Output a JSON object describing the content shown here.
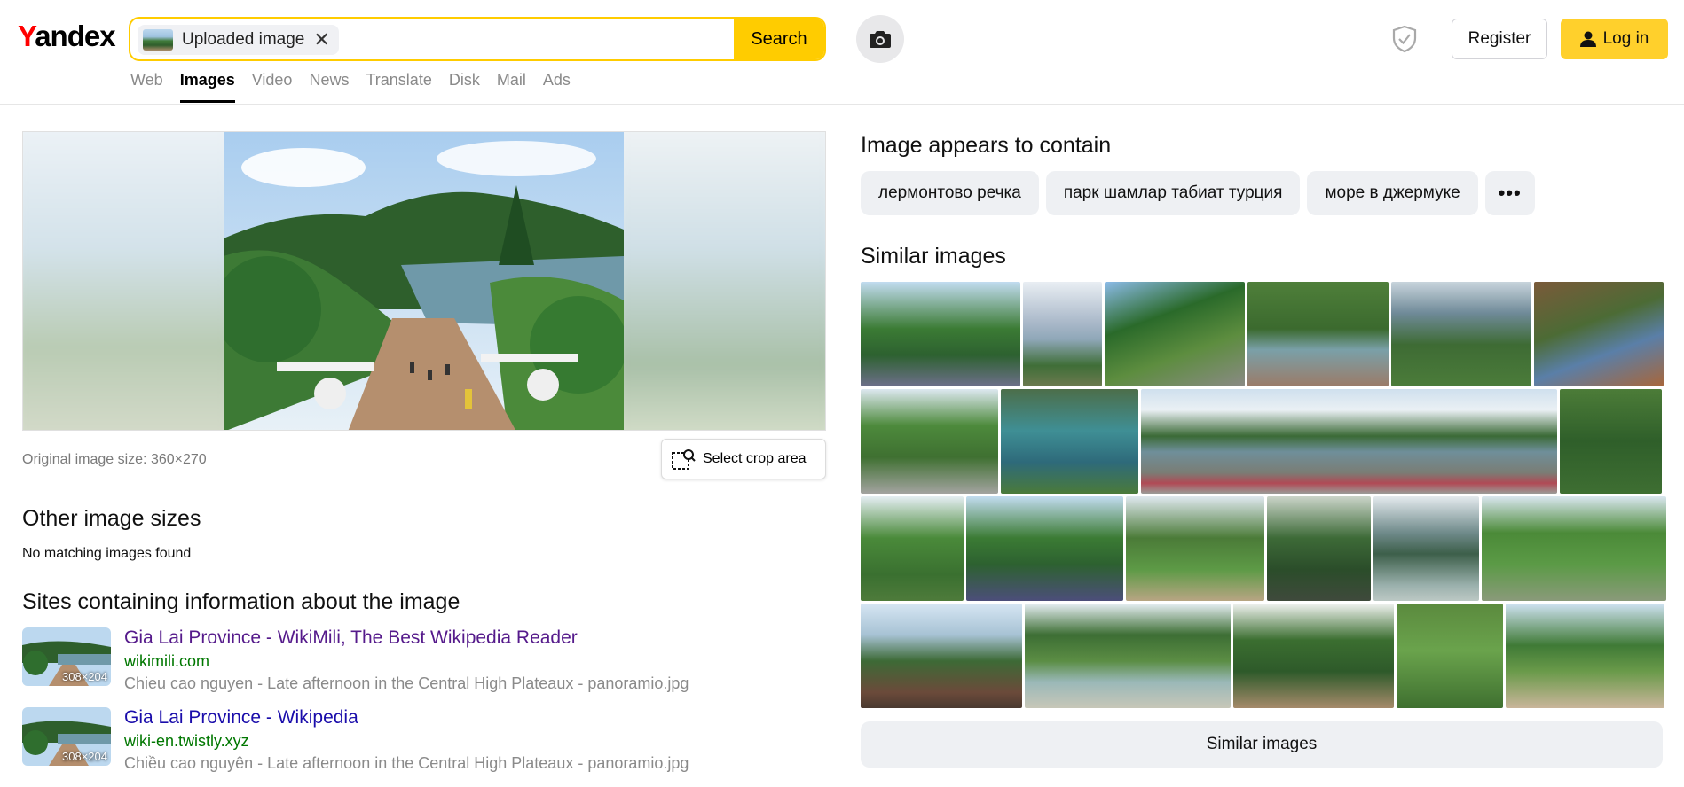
{
  "header": {
    "logo_first": "Y",
    "logo_rest": "andex",
    "search_chip_label": "Uploaded image",
    "search_chip_close": "✕",
    "search_button": "Search",
    "register": "Register",
    "login": "Log in"
  },
  "nav": {
    "items": [
      "Web",
      "Images",
      "Video",
      "News",
      "Translate",
      "Disk",
      "Mail",
      "Ads"
    ],
    "active": "Images"
  },
  "preview": {
    "original_size": "Original image size: 360×270",
    "crop_button": "Select crop area"
  },
  "other_sizes": {
    "heading": "Other image sizes",
    "message": "No matching images found"
  },
  "sites": {
    "heading": "Sites containing information about the image",
    "items": [
      {
        "title": "Gia Lai Province - WikiMili, The Best Wikipedia Reader",
        "url": "wikimili.com",
        "desc": "Chieu cao nguyen - Late afternoon in the Central High Plateaux - panoramio.jpg",
        "thumb_size": "308×204",
        "title_color": "#551a8b"
      },
      {
        "title": "Gia Lai Province - Wikipedia",
        "url": "wiki-en.twistly.xyz",
        "desc": "Chiều cao nguyên - Late afternoon in the Central High Plateaux - panoramio.jpg",
        "thumb_size": "308×204",
        "title_color": "#1a0dab"
      }
    ]
  },
  "contains": {
    "heading": "Image appears to contain",
    "tags": [
      "лермонтово речка",
      "парк шамлар табиат турция",
      "море в джермуке"
    ],
    "more": "•••"
  },
  "similar": {
    "heading": "Similar images",
    "button": "Similar images"
  },
  "colors": {
    "accent": "#ffcc00",
    "login_bg": "#ffd02c",
    "url_green": "#007700",
    "muted": "#8a8a8a"
  }
}
